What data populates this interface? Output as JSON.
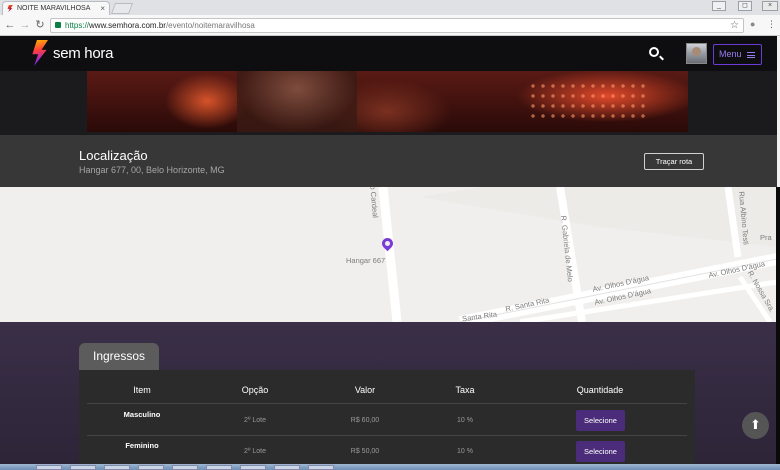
{
  "browser": {
    "tab_title": "NOITE MARAVILHOSA",
    "tab_close": "×",
    "url_protocol": "https://",
    "url_host": "www.semhora.com.br",
    "url_path": "/evento/noitemaravilhosa",
    "star": "☆",
    "back": "←",
    "forward": "→",
    "reload": "↻",
    "window_controls": [
      "_",
      "◻",
      "×"
    ]
  },
  "header": {
    "logo_text": "sem hora",
    "menu_label": "Menu"
  },
  "location": {
    "title": "Localização",
    "address": "Hangar 677, 00, Belo Horizonte, MG",
    "route_button": "Traçar rota"
  },
  "map": {
    "pin_label": "Hangar 667",
    "streets": [
      "R. Gabriela de Melo",
      "R. Santa Rita",
      "Av. Olhos D'água",
      "Av. Olhos D'água",
      "Rua Albino Testi",
      "Av. Olhos D'água",
      "R. Nossa Sra.",
      "Pra",
      "to Cardeal",
      "Santa Rita"
    ]
  },
  "tickets": {
    "tab_label": "Ingressos",
    "columns": [
      "Item",
      "Opção",
      "Valor",
      "Taxa",
      "Quantidade"
    ],
    "rows": [
      {
        "item": "Masculino",
        "option": "2º Lote",
        "value": "R$ 60,00",
        "fee": "10 %",
        "action": "Selecione"
      },
      {
        "item": "Feminino",
        "option": "2º Lote",
        "value": "R$ 50,00",
        "fee": "10 %",
        "action": "Selecione"
      }
    ]
  },
  "icons": {
    "up": "⬆",
    "search": "search-icon",
    "menu": "hamburger-icon"
  }
}
